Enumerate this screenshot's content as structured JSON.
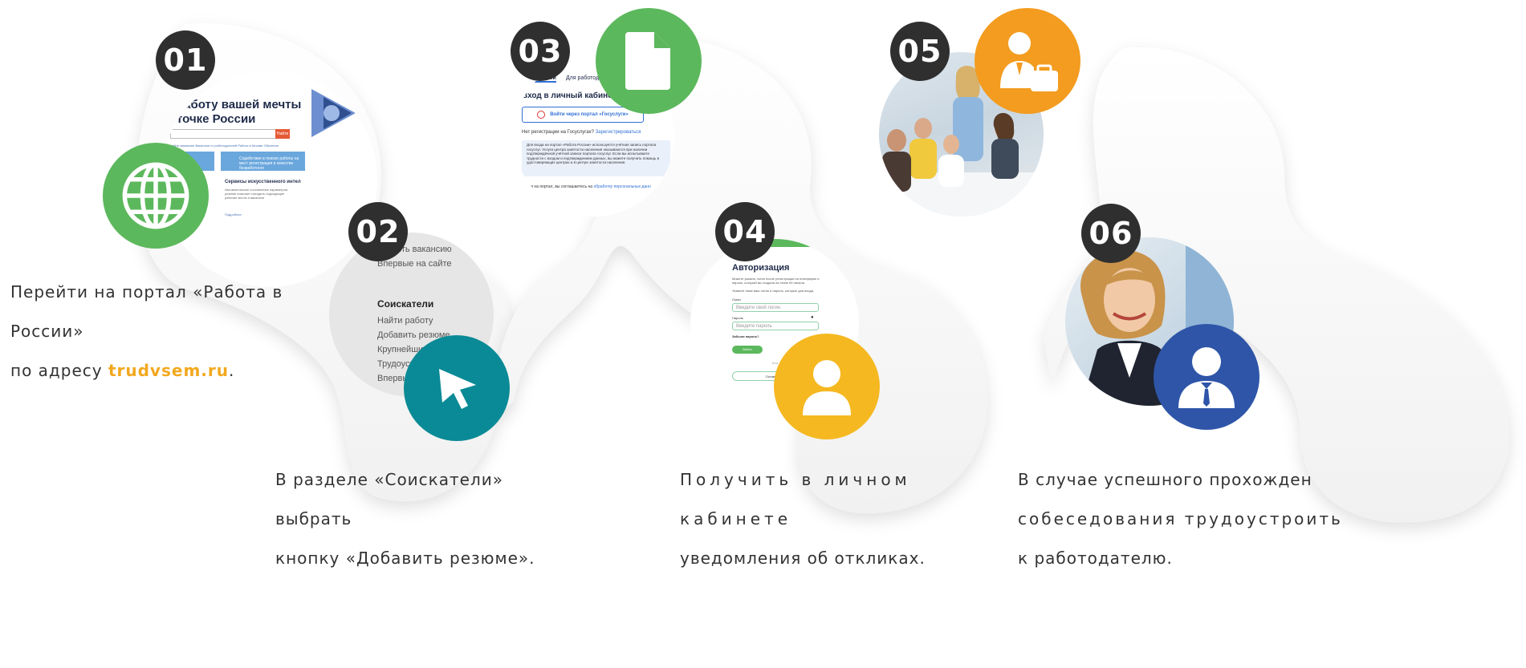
{
  "steps": [
    {
      "number": "01",
      "text_before": "Перейти на портал «Работа в России»",
      "text_line2_prefix": "по адресу ",
      "link": "trudvsem.ru",
      "text_line2_suffix": ".",
      "screenshot": {
        "headline_1": "работу вашей мечты",
        "headline_2": "точке России",
        "search_button": "Найти",
        "card_text": "Содействие в поиске работы на мест регистрация в качестве безработного",
        "ai_title": "Сервисы искусственного интел",
        "ai_text": "Автоматическое составление параметров резюме помогает находить подходящие рабочие места и вакансии",
        "more": "Подробнее",
        "tiny_links": "Найти вакансию  Вакансии от работодателей  Работа в Москве  Обучение"
      },
      "icon": "globe-icon",
      "icon_color": "#5cb85c"
    },
    {
      "number": "02",
      "text_line1": "В разделе «Соискатели» выбрать",
      "text_line2": "кнопку «Добавить резюме».",
      "screenshot": {
        "top_item_1": "Добавить вакансию",
        "top_item_2": "Впервые на сайте",
        "section_title": "Соискатели",
        "items": [
          "Найти работу",
          "Добавить резюме",
          "Крупнейшие",
          "Трудоустр",
          "Впервые"
        ]
      },
      "icon": "cursor-icon",
      "icon_color": "#0a8a96"
    },
    {
      "number": "03",
      "screenshot": {
        "tab_1": "Соискателей",
        "tab_2": "Для работодате",
        "title": "Вход в личный кабинет со",
        "gosuslugi_button": "Войти через портал «Госуслуги»",
        "no_registration": "Нет регистрации на Госуслугах?",
        "register_link": "Зарегистрироваться",
        "info_text": "Для входа на портал «Работа России» используется учётная запись портала госуслуг. Услуги центра занятости населения оказываются при наличии подтверждённой учётной записи портала госуслуг. Если вы испытываете трудности с входом и подтверждением данных, вы можете получить помощь в удостоверяющих центрах и в центре занятости населения.",
        "consent_text": "Входя на портал, вы соглашаетесь на",
        "consent_link": "обработку персональных данн"
      },
      "icon": "document-icon",
      "icon_color": "#5cb85c"
    },
    {
      "number": "04",
      "text_line1": "Получить в личном кабинете",
      "text_line2": "уведомления об откликах.",
      "screenshot": {
        "title": "Авторизация",
        "desc_1": "Можете указать логин после регистрации на платформе и пароль, который вы создали на этапе её начала.",
        "desc_2": "Укажите ниже ваш логин и пароль, которые для входа.",
        "login_label": "Логин",
        "login_placeholder": "Введите свой логин",
        "password_label": "Пароль",
        "password_placeholder": "Введите пароль",
        "forgot": "Забыли пароль?",
        "login_button": "Войти",
        "or": "или",
        "leave_button": "Оставить зая"
      },
      "icon": "user-icon",
      "icon_color": "#f5b820"
    },
    {
      "number": "05",
      "photo": "meeting-photo",
      "icon": "manager-briefcase-icon",
      "icon_color": "#f39c1f"
    },
    {
      "number": "06",
      "text_line1": "В случае успешного прохожден",
      "text_line2": "собеседования трудоустроить",
      "text_line3": "к работодателю.",
      "photo": "businesswoman-photo",
      "icon": "employee-icon",
      "icon_color": "#2e55a8"
    }
  ]
}
